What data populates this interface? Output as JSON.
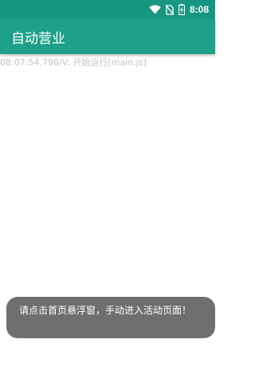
{
  "status_bar": {
    "time": "8:08",
    "icons": [
      "wifi-icon",
      "no-sim-icon",
      "battery-charging-icon"
    ]
  },
  "app_bar": {
    "title": "自动营业"
  },
  "log": {
    "lines": [
      "08:07:54.796/V: 开始运行[main.js]"
    ]
  },
  "toast": {
    "message": "请点击首页悬浮窗，手动进入活动页面！"
  },
  "colors": {
    "status_bar": "#179682",
    "app_bar": "#1ea08a",
    "log_text": "#c2c2c2",
    "toast_bg": "#6f6f6f"
  }
}
